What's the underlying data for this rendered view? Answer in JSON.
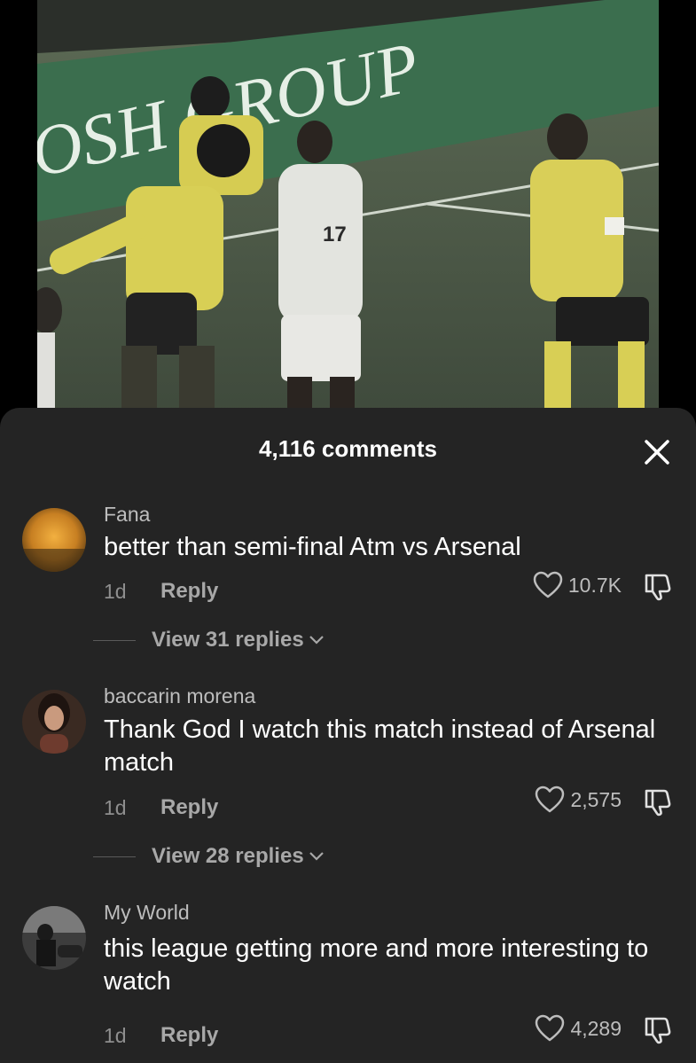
{
  "video": {
    "banner_text": "OSH GROUP",
    "jersey_number": "17"
  },
  "sheet": {
    "comment_count": "4,116 comments",
    "close_icon": "close-icon"
  },
  "comments": [
    {
      "username": "Fana",
      "text": "better than semi-final Atm vs Arsenal",
      "time": "1d",
      "reply_label": "Reply",
      "likes": "10.7K",
      "view_replies": "View 31 replies"
    },
    {
      "username": "baccarin morena",
      "text": "Thank God I watch this match instead of Arsenal match",
      "time": "1d",
      "reply_label": "Reply",
      "likes": "2,575",
      "view_replies": "View 28 replies"
    },
    {
      "username": "My World",
      "text": "this league getting more and more interesting to watch",
      "time": "1d",
      "reply_label": "Reply",
      "likes": "4,289"
    }
  ]
}
